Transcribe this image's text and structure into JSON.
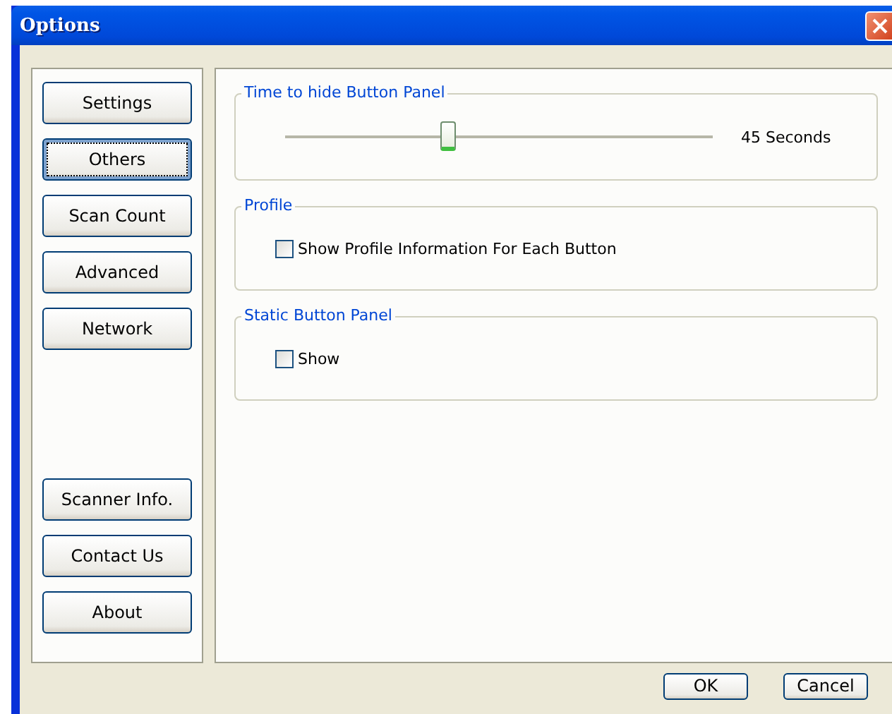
{
  "window": {
    "title": "Options"
  },
  "nav": {
    "top_buttons": [
      {
        "label": "Settings",
        "selected": false
      },
      {
        "label": "Others",
        "selected": true
      },
      {
        "label": "Scan Count",
        "selected": false
      },
      {
        "label": "Advanced",
        "selected": false
      },
      {
        "label": "Network",
        "selected": false
      }
    ],
    "bottom_buttons": [
      {
        "label": "Scanner Info.",
        "selected": false
      },
      {
        "label": "Contact Us",
        "selected": false
      },
      {
        "label": "About",
        "selected": false
      }
    ]
  },
  "groups": [
    {
      "kind": "slider",
      "title": "Time to hide Button Panel",
      "level": 0.38,
      "reading": "45 Seconds"
    },
    {
      "kind": "checkbox",
      "title": "Profile",
      "label": "Show Profile Information For Each Button",
      "checked": false
    },
    {
      "kind": "checkbox",
      "title": "Static Button Panel",
      "label": "Show",
      "checked": false
    }
  ],
  "buttons": [
    "OK",
    "Cancel"
  ]
}
